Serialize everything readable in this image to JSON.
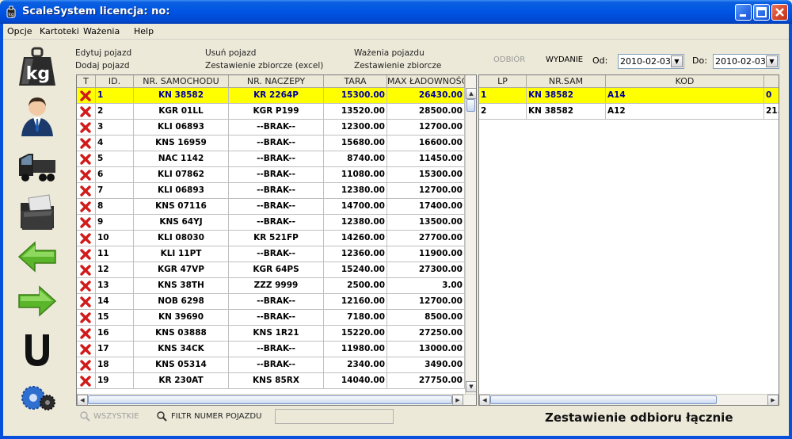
{
  "window": {
    "title": "ScaleSystem licencja:  no:"
  },
  "menu": {
    "items": [
      "Opcje",
      "Kartoteki",
      "Ważenia",
      "Help"
    ]
  },
  "actions": {
    "edit_vehicle": "Edytuj pojazd",
    "add_vehicle": "Dodaj pojazd",
    "delete_vehicle": "Usuń pojazd",
    "summary_excel": "Zestawienie zbiorcze (excel)",
    "vehicle_weighings": "Ważenia pojazdu",
    "summary": "Zestawienie zbiorcze"
  },
  "filter_panel": {
    "odbior": "ODBIÓR",
    "wydanie": "WYDANIE",
    "od_label": "Od:",
    "do_label": "Do:",
    "date_from": "2010-02-03",
    "date_to": "2010-02-03"
  },
  "vehicles_table": {
    "columns": [
      "T",
      "ID.",
      "NR. SAMOCHODU",
      "NR. NACZEPY",
      "TARA",
      "MAX ŁADOWNOŚĆ"
    ],
    "rows": [
      {
        "id": "1",
        "car": "KN 38582",
        "trailer": "KR 2264P",
        "tara": "15300.00",
        "max": "26430.00"
      },
      {
        "id": "2",
        "car": "KGR 01LL",
        "trailer": "KGR P199",
        "tara": "13520.00",
        "max": "28500.00"
      },
      {
        "id": "3",
        "car": "KLI 06893",
        "trailer": "--BRAK--",
        "tara": "12300.00",
        "max": "12700.00"
      },
      {
        "id": "4",
        "car": "KNS 16959",
        "trailer": "--BRAK--",
        "tara": "15680.00",
        "max": "16600.00"
      },
      {
        "id": "5",
        "car": "NAC 1142",
        "trailer": "--BRAK--",
        "tara": "8740.00",
        "max": "11450.00"
      },
      {
        "id": "6",
        "car": "KLI 07862",
        "trailer": "--BRAK--",
        "tara": "11080.00",
        "max": "15300.00"
      },
      {
        "id": "7",
        "car": "KLI 06893",
        "trailer": "--BRAK--",
        "tara": "12380.00",
        "max": "12700.00"
      },
      {
        "id": "8",
        "car": "KNS 07116",
        "trailer": "--BRAK--",
        "tara": "14700.00",
        "max": "17400.00"
      },
      {
        "id": "9",
        "car": "KNS 64YJ",
        "trailer": "--BRAK--",
        "tara": "12380.00",
        "max": "13500.00"
      },
      {
        "id": "10",
        "car": "KLI 08030",
        "trailer": "KR 521FP",
        "tara": "14260.00",
        "max": "27700.00"
      },
      {
        "id": "11",
        "car": "KLI 11PT",
        "trailer": "--BRAK--",
        "tara": "12360.00",
        "max": "11900.00"
      },
      {
        "id": "12",
        "car": "KGR 47VP",
        "trailer": "KGR 64PS",
        "tara": "15240.00",
        "max": "27300.00"
      },
      {
        "id": "13",
        "car": "KNS 38TH",
        "trailer": "ZZZ 9999",
        "tara": "2500.00",
        "max": "3.00"
      },
      {
        "id": "14",
        "car": "NOB 6298",
        "trailer": "--BRAK--",
        "tara": "12160.00",
        "max": "12700.00"
      },
      {
        "id": "15",
        "car": "KN 39690",
        "trailer": "--BRAK--",
        "tara": "7180.00",
        "max": "8500.00"
      },
      {
        "id": "16",
        "car": "KNS 03888",
        "trailer": "KNS 1R21",
        "tara": "15220.00",
        "max": "27250.00"
      },
      {
        "id": "17",
        "car": "KNS 34CK",
        "trailer": "--BRAK--",
        "tara": "11980.00",
        "max": "13000.00"
      },
      {
        "id": "18",
        "car": "KNS 05314",
        "trailer": "--BRAK--",
        "tara": "2340.00",
        "max": "3490.00"
      },
      {
        "id": "19",
        "car": "KR 230AT",
        "trailer": "KNS 85RX",
        "tara": "14040.00",
        "max": "27750.00"
      }
    ]
  },
  "weighings_table": {
    "columns": [
      "LP",
      "NR.SAM",
      "KOD",
      ""
    ],
    "rows": [
      {
        "lp": "1",
        "nr": "KN 38582",
        "kod": "A14",
        "extra": "0"
      },
      {
        "lp": "2",
        "nr": "KN 38582",
        "kod": "A12",
        "extra": "21."
      }
    ]
  },
  "bottom": {
    "all_label": "WSZYSTKIE",
    "filter_label": "FILTR NUMER POJAZDU",
    "filter_value": "",
    "summary_text": "Zestawienie odbioru łącznie"
  }
}
